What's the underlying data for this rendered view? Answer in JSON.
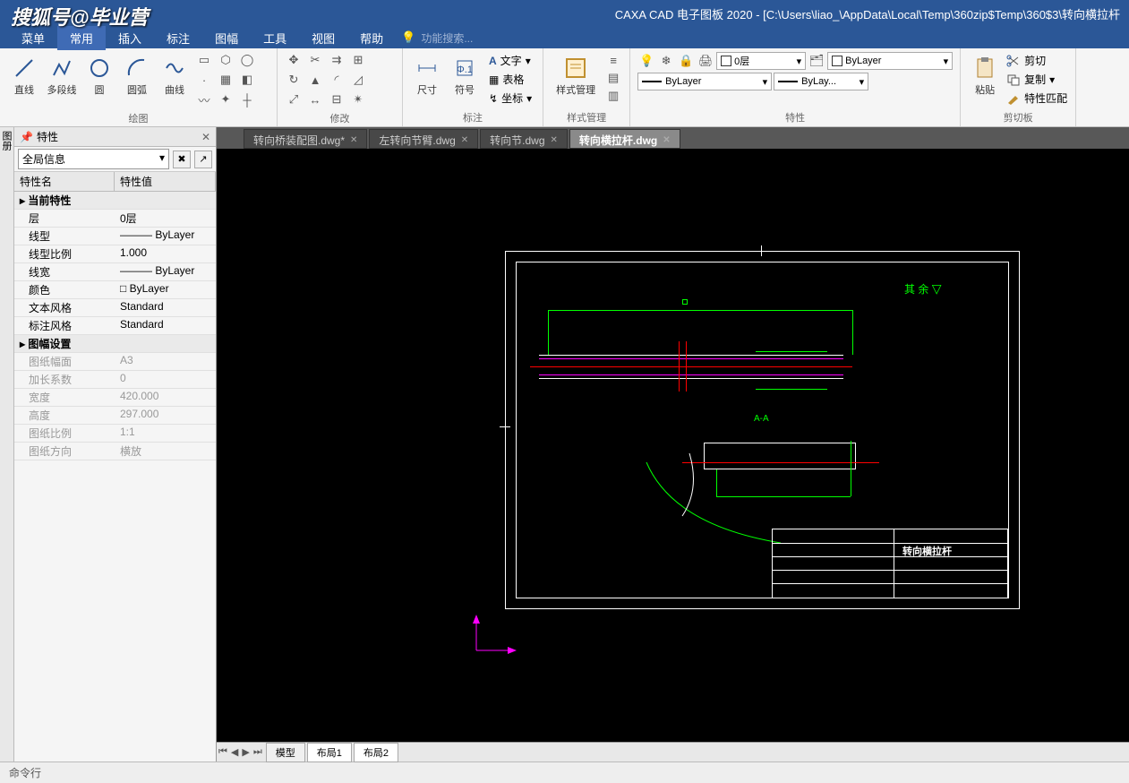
{
  "watermark": "搜狐号@毕业营",
  "title": "CAXA CAD 电子图板 2020 - [C:\\Users\\liao_\\AppData\\Local\\Temp\\360zip$Temp\\360$3\\转向横拉杆",
  "menu": {
    "items": [
      "菜单",
      "常用",
      "插入",
      "标注",
      "图幅",
      "工具",
      "视图",
      "帮助"
    ],
    "active": 1,
    "search_placeholder": "功能搜索..."
  },
  "ribbon": {
    "draw": {
      "label": "绘图",
      "line": "直线",
      "pline": "多段线",
      "circle": "圆",
      "arc": "圆弧",
      "spline": "曲线"
    },
    "modify": {
      "label": "修改"
    },
    "annotate": {
      "label": "标注",
      "dim": "尺寸",
      "symbol": "符号",
      "text": "文字",
      "table": "表格",
      "coord": "坐标"
    },
    "style": {
      "label": "样式管理",
      "btn": "样式管理"
    },
    "prop": {
      "label": "特性",
      "layer": "0层",
      "bylayer1": "ByLayer",
      "bylayer2": "ByLayer",
      "bylayer3": "ByLay..."
    },
    "clip": {
      "label": "剪切板",
      "paste": "粘贴",
      "cut": "剪切",
      "copy": "复制",
      "match": "特性匹配"
    }
  },
  "doc_tabs": [
    {
      "label": "转向桥装配图.dwg*"
    },
    {
      "label": "左转向节臂.dwg"
    },
    {
      "label": "转向节.dwg"
    },
    {
      "label": "转向横拉杆.dwg",
      "active": true
    }
  ],
  "left": {
    "title": "特性",
    "tab_label": "图册",
    "combo": "全局信息",
    "col_name": "特性名",
    "col_val": "特性值",
    "sections": [
      {
        "name": "当前特性",
        "rows": [
          {
            "n": "层",
            "v": "0层"
          },
          {
            "n": "线型",
            "v": "——— ByLayer"
          },
          {
            "n": "线型比例",
            "v": "1.000"
          },
          {
            "n": "线宽",
            "v": "——— ByLayer"
          },
          {
            "n": "颜色",
            "v": "□ ByLayer"
          },
          {
            "n": "文本风格",
            "v": "Standard"
          },
          {
            "n": "标注风格",
            "v": "Standard"
          }
        ]
      },
      {
        "name": "图幅设置",
        "rows": [
          {
            "n": "图纸幅面",
            "v": "A3",
            "d": true
          },
          {
            "n": "加长系数",
            "v": "0",
            "d": true
          },
          {
            "n": "宽度",
            "v": "420.000",
            "d": true
          },
          {
            "n": "高度",
            "v": "297.000",
            "d": true
          },
          {
            "n": "图纸比例",
            "v": "1:1",
            "d": true
          },
          {
            "n": "图纸方向",
            "v": "横放",
            "d": true
          }
        ]
      }
    ]
  },
  "bottom_tabs": {
    "model": "模型",
    "layout1": "布局1",
    "layout2": "布局2"
  },
  "status": "命令行",
  "drawing": {
    "title_block": "转向横拉杆",
    "annotation": "其 余",
    "section": "A-A"
  }
}
